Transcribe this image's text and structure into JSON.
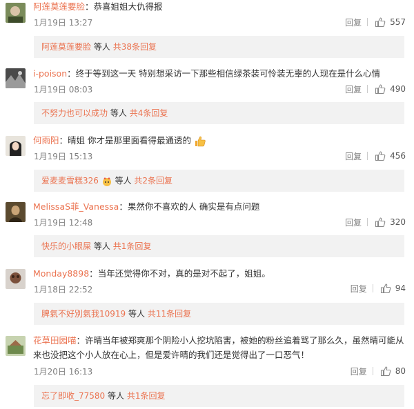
{
  "comments": [
    {
      "user": "阿莲莫莲要脸",
      "text": "恭喜姐姐大仇得报",
      "time": "1月19日 13:27",
      "reply_label": "回复",
      "likes": "557",
      "sub": {
        "user": "阿莲莫莲要脸",
        "mid": "等人",
        "count": "共38条回复"
      }
    },
    {
      "user": "i-poison",
      "text": "终于等到这一天 特别想采访一下那些相信绿茶装可怜装无辜的人现在是什么心情",
      "time": "1月19日 08:03",
      "reply_label": "回复",
      "likes": "490",
      "sub": {
        "user": "不努力也可以成功",
        "mid": "等人",
        "count": "共4条回复"
      }
    },
    {
      "user": "何雨阳",
      "text": "晴姐 你才是那里面看得最通透的",
      "time": "1月19日 15:13",
      "reply_label": "回复",
      "likes": "456",
      "sub": {
        "user": "爱麦麦雪糕326",
        "mid": "等人",
        "count": "共2条回复"
      }
    },
    {
      "user": "MelissaS菲_Vanessa",
      "text": "果然你不喜欢的人 确实是有点问题",
      "time": "1月19日 12:48",
      "reply_label": "回复",
      "likes": "320",
      "sub": {
        "user": "快乐的小眼屎",
        "mid": "等人",
        "count": "共1条回复"
      }
    },
    {
      "user": "Monday8898",
      "text": "当年还觉得你不对，真的是对不起了，姐姐。",
      "time": "1月18日 22:52",
      "reply_label": "回复",
      "likes": "94",
      "sub": {
        "user": "脾氣不好別氣我10919",
        "mid": "等人",
        "count": "共11条回复"
      }
    },
    {
      "user": "花草田园喵",
      "text": "许晴当年被郑爽那个阴险小人挖坑陷害，被她的粉丝追着骂了那么久，虽然晴可能从来也没把这个小人放在心上，但是爱许晴的我们还是觉得出了一口恶气！",
      "time": "1月20日 16:13",
      "reply_label": "回复",
      "likes": "80",
      "sub": {
        "user": "忘了即收_77580",
        "mid": "等人",
        "count": "共1条回复"
      }
    }
  ]
}
